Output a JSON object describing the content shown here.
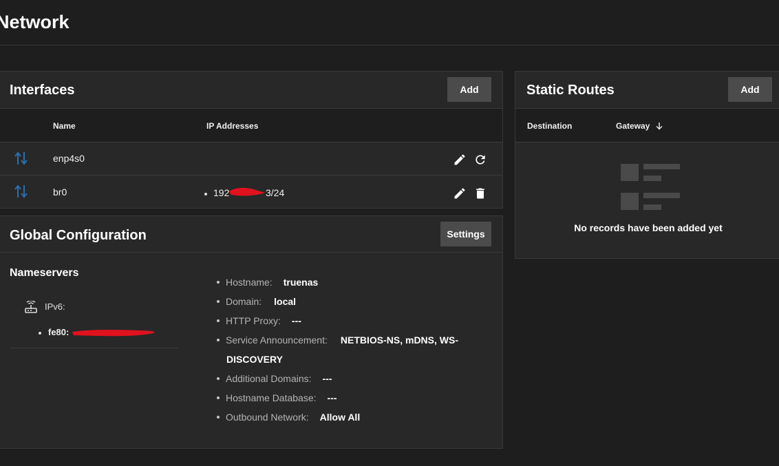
{
  "page": {
    "title": "Network"
  },
  "interfaces": {
    "title": "Interfaces",
    "add_label": "Add",
    "columns": {
      "name": "Name",
      "ip": "IP Addresses"
    },
    "rows": [
      {
        "name": "enp4s0",
        "ip": ""
      },
      {
        "name": "br0",
        "ip_prefix": "192",
        "ip_suffix": "3/24"
      }
    ]
  },
  "global_config": {
    "title": "Global Configuration",
    "settings_label": "Settings",
    "nameservers": {
      "title": "Nameservers",
      "ipv6_label": "IPv6:",
      "ipv6_prefix": "fe80:"
    },
    "items": [
      {
        "key": "Hostname:",
        "value": "truenas"
      },
      {
        "key": "Domain:",
        "value": "local"
      },
      {
        "key": "HTTP Proxy:",
        "value": "---"
      },
      {
        "key": "Service Announcement:",
        "value": "NETBIOS-NS, mDNS, WS-",
        "value_cont": "DISCOVERY"
      },
      {
        "key": "Additional Domains:",
        "value": "---"
      },
      {
        "key": "Hostname Database:",
        "value": "---"
      },
      {
        "key": "Outbound Network:",
        "value": "Allow All"
      }
    ]
  },
  "static_routes": {
    "title": "Static Routes",
    "add_label": "Add",
    "columns": {
      "destination": "Destination",
      "gateway": "Gateway"
    },
    "empty_text": "No records have been added yet"
  },
  "colors": {
    "background": "#1e1e1e",
    "card": "#282828",
    "button": "#4b4b4b",
    "interface_icon": "#2a6fb0",
    "redaction": "#e0121d"
  },
  "icons": {
    "interface": "arrows-up-down-icon",
    "edit": "pencil-icon",
    "reset": "refresh-icon",
    "delete": "trash-icon",
    "nameserver": "router-icon",
    "sort": "arrow-down-icon",
    "empty": "empty-list-icon"
  }
}
